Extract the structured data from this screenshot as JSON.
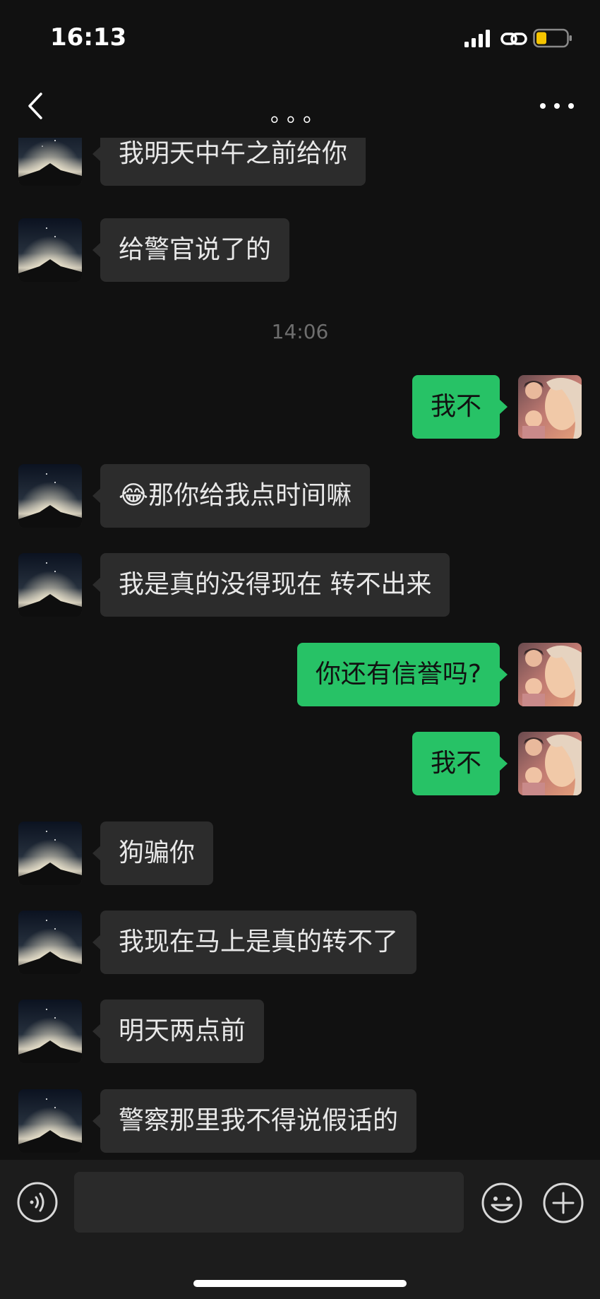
{
  "status_bar": {
    "time": "16:13",
    "icons": [
      "signal-icon",
      "link-icon",
      "battery-icon"
    ],
    "battery_level": 0.35,
    "battery_color": "#f5c400"
  },
  "nav": {
    "back_icon": "chevron-left-icon",
    "title": "。。。",
    "more_icon": "more-horizontal-icon"
  },
  "colors": {
    "background": "#111111",
    "incoming_bubble": "#2c2c2c",
    "outgoing_bubble": "#27c266",
    "input_bar": "#1c1c1c"
  },
  "messages": [
    {
      "type": "in",
      "text": "我明天中午之前给你"
    },
    {
      "type": "in",
      "text": "给警官说了的"
    },
    {
      "type": "time",
      "text": "14:06"
    },
    {
      "type": "out",
      "text": "我不"
    },
    {
      "type": "in",
      "emoji": "😂",
      "text": "那你给我点时间嘛"
    },
    {
      "type": "in",
      "text": "我是真的没得现在 转不出来"
    },
    {
      "type": "out",
      "text": "你还有信誉吗?"
    },
    {
      "type": "out",
      "text": "我不"
    },
    {
      "type": "in",
      "text": "狗骗你"
    },
    {
      "type": "in",
      "text": "我现在马上是真的转不了"
    },
    {
      "type": "in",
      "text": "明天两点前"
    },
    {
      "type": "in",
      "text": "警察那里我不得说假话的"
    }
  ],
  "input_bar": {
    "placeholder": "",
    "value": "",
    "icons": [
      "voice-icon",
      "emoji-icon",
      "plus-icon"
    ]
  }
}
